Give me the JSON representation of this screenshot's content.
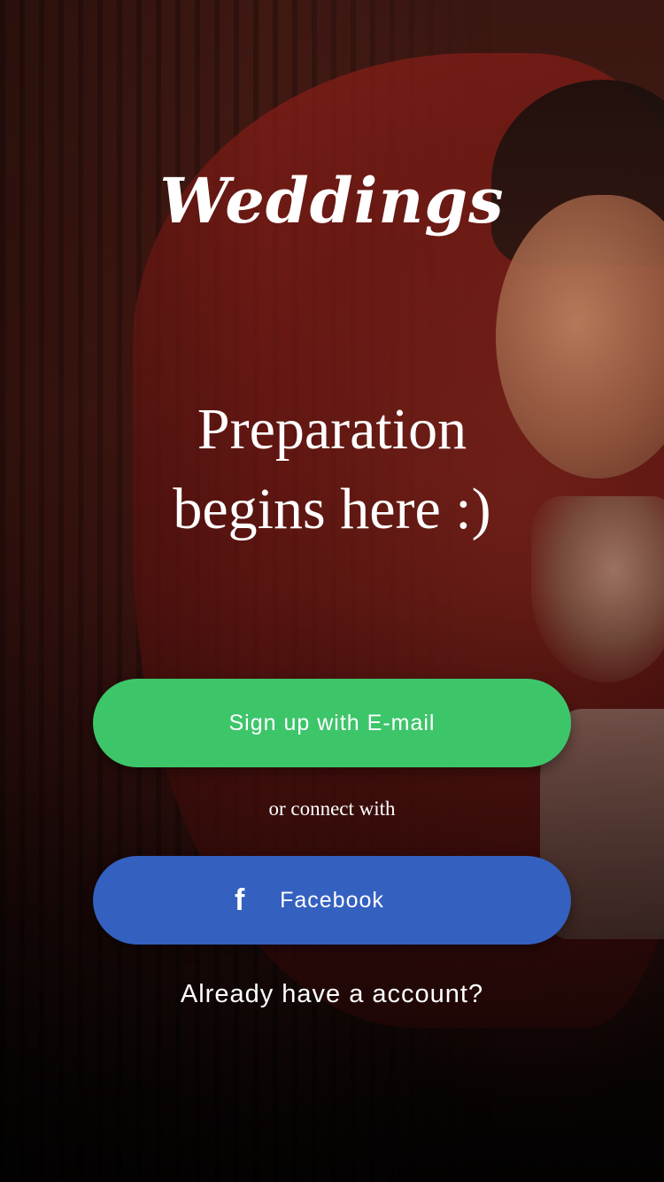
{
  "app": {
    "logo": "Weddings"
  },
  "hero": {
    "tagline_line1": "Preparation",
    "tagline_line2": "begins here :)"
  },
  "actions": {
    "email_signup_label": "Sign up with E-mail",
    "divider_text": "or connect with",
    "facebook_label": "Facebook",
    "facebook_icon": "f",
    "login_link": "Already have a account?"
  },
  "colors": {
    "email_button": "#3dc56a",
    "facebook_button": "#3460c0",
    "text": "#ffffff"
  }
}
